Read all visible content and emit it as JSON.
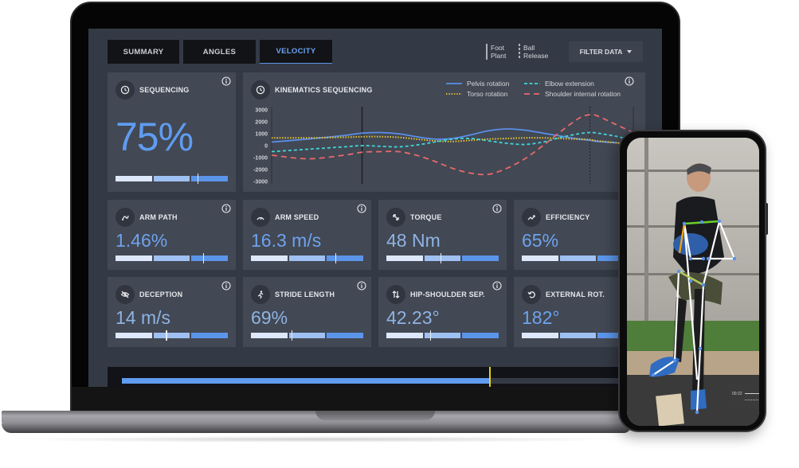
{
  "tabs": [
    {
      "label": "SUMMARY",
      "active": false
    },
    {
      "label": "ANGLES",
      "active": false
    },
    {
      "label": "VELOCITY",
      "active": true
    }
  ],
  "event_markers": {
    "foot_plant": [
      "Foot",
      "Plant"
    ],
    "ball_release": [
      "Ball",
      "Release"
    ]
  },
  "filter_button": {
    "label": "FILTER DATA",
    "icon": "caret-down-icon"
  },
  "sequencing_card": {
    "title": "SEQUENCING",
    "icon": "clock-icon",
    "value": "75%",
    "meter_position": 0.73
  },
  "chart_card": {
    "title": "KINEMATICS SEQUENCING",
    "icon": "clock-icon"
  },
  "metrics": [
    {
      "title": "ARM PATH",
      "icon": "arm-path-icon",
      "value": "1.46%",
      "meter_position": 0.78,
      "has_info": true
    },
    {
      "title": "ARM SPEED",
      "icon": "speedometer-icon",
      "value": "16.3 m/s",
      "meter_position": 0.75,
      "has_info": true
    },
    {
      "title": "TORQUE",
      "icon": "expand-arrows-icon",
      "value": "48 Nm",
      "meter_position": 0.48,
      "has_info": true
    },
    {
      "title": "EFFICIENCY",
      "icon": "trending-up-icon",
      "value": "65%",
      "meter_position": 0.86,
      "has_info": false
    },
    {
      "title": "DECEPTION",
      "icon": "eye-off-icon",
      "value": "14 m/s",
      "meter_position": 0.45,
      "has_info": true
    },
    {
      "title": "STRIDE LENGTH",
      "icon": "running-icon",
      "value": "69%",
      "meter_position": 0.36,
      "has_info": true
    },
    {
      "title": "HIP-SHOULDER SEP.",
      "icon": "swap-vertical-icon",
      "value": "42.23°",
      "meter_position": 0.39,
      "has_info": true
    },
    {
      "title": "EXTERNAL ROT.",
      "icon": "rotate-icon",
      "value": "182°",
      "meter_position": 0.86,
      "has_info": false
    }
  ],
  "timeline": {
    "progress": 0.72
  },
  "phone_video": {
    "timestamp": "00:22"
  },
  "colors": {
    "accent": "#5f9cf0",
    "pelvis": "#5b8fe8",
    "torso": "#e8c832",
    "elbow": "#3fd6d6",
    "shoulder": "#e86a6a",
    "playhead": "#e4d21a"
  },
  "chart_data": {
    "type": "line",
    "title": "KINEMATICS SEQUENCING",
    "xlabel": "",
    "ylabel": "",
    "x": [
      0,
      10,
      20,
      25,
      30,
      35,
      40,
      45,
      50,
      55,
      60,
      65,
      70,
      75,
      80,
      85,
      88,
      90,
      95,
      100
    ],
    "ylim": [
      -3000,
      3000
    ],
    "yticks": [
      3000,
      2000,
      1000,
      0,
      -1000,
      -2000,
      -3000
    ],
    "ytick_labels": [
      "3000",
      "2000",
      "1000",
      "0",
      "-1000",
      "-2000",
      "-3000"
    ],
    "legend": "top-right",
    "grid": false,
    "series": [
      {
        "name": "Pelvis rotation",
        "style": "solid",
        "values": [
          300,
          550,
          850,
          1050,
          1100,
          1000,
          750,
          550,
          600,
          900,
          1250,
          1400,
          1300,
          1050,
          800,
          550,
          450,
          350,
          250,
          100
        ]
      },
      {
        "name": "Torso rotation",
        "style": "dotted",
        "values": [
          650,
          650,
          700,
          750,
          750,
          700,
          550,
          400,
          350,
          450,
          550,
          600,
          650,
          650,
          600,
          550,
          500,
          400,
          250,
          50
        ]
      },
      {
        "name": "Elbow extension",
        "style": "dashed",
        "values": [
          -500,
          -300,
          -100,
          0,
          -50,
          -100,
          50,
          300,
          550,
          600,
          400,
          200,
          100,
          300,
          700,
          1000,
          1100,
          1050,
          800,
          450
        ]
      },
      {
        "name": "Shoulder internal rotation",
        "style": "long-dashed",
        "values": [
          -800,
          -1100,
          -800,
          -550,
          -500,
          -500,
          -800,
          -1300,
          -1900,
          -2300,
          -2400,
          -1900,
          -1100,
          0,
          1200,
          2300,
          2600,
          2500,
          1800,
          1100
        ]
      }
    ],
    "vertical_markers": [
      {
        "label": "Foot Plant",
        "x": 25,
        "style": "solid"
      },
      {
        "label": "Ball Release",
        "x": 88,
        "style": "dashed"
      }
    ]
  }
}
